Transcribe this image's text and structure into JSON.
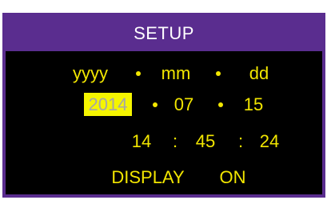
{
  "title": "SETUP",
  "format_row": {
    "year_label": "yyyy",
    "month_label": "mm",
    "day_label": "dd"
  },
  "date_row": {
    "year": "2014",
    "month": "07",
    "day": "15",
    "selected_field": "year"
  },
  "time_row": {
    "hours": "14",
    "minutes": "45",
    "seconds": "24",
    "separator": ":"
  },
  "display_row": {
    "label": "DISPLAY",
    "value": "ON"
  },
  "colors": {
    "frame": "#5a2d8f",
    "background": "#000000",
    "text": "#f2e600",
    "highlight_bg": "#f5f500",
    "highlight_text": "#a6a6a6"
  }
}
